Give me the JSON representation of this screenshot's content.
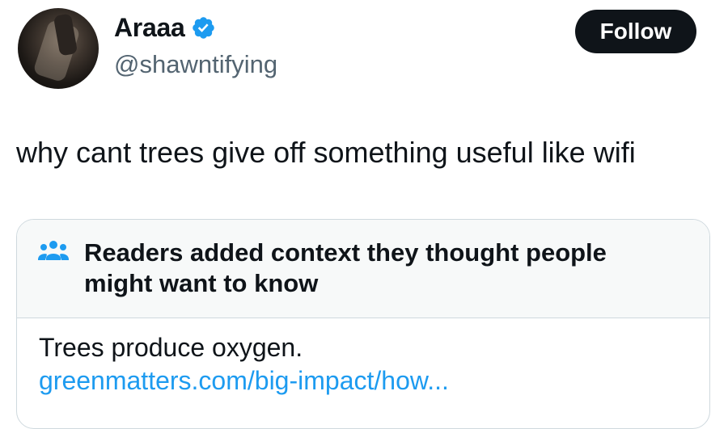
{
  "author": {
    "display_name": "Araaa",
    "handle": "@shawntifying",
    "verified": true,
    "follow_label": "Follow"
  },
  "tweet": {
    "text": "why cant trees give off something useful like wifi"
  },
  "community_note": {
    "title": "Readers added context they thought people might want to know",
    "body": "Trees produce oxygen.",
    "link": "greenmatters.com/big-impact/how..."
  },
  "icons": {
    "verified": "verified-badge-icon",
    "note": "people-group-icon"
  },
  "colors": {
    "verified_blue": "#1d9bf0",
    "link_blue": "#1d9bf0",
    "follow_button_bg": "#0f1419",
    "text": "#0f1419",
    "secondary_text": "#536471",
    "note_header_bg": "#f7f9f9",
    "border": "#cfd9de"
  }
}
